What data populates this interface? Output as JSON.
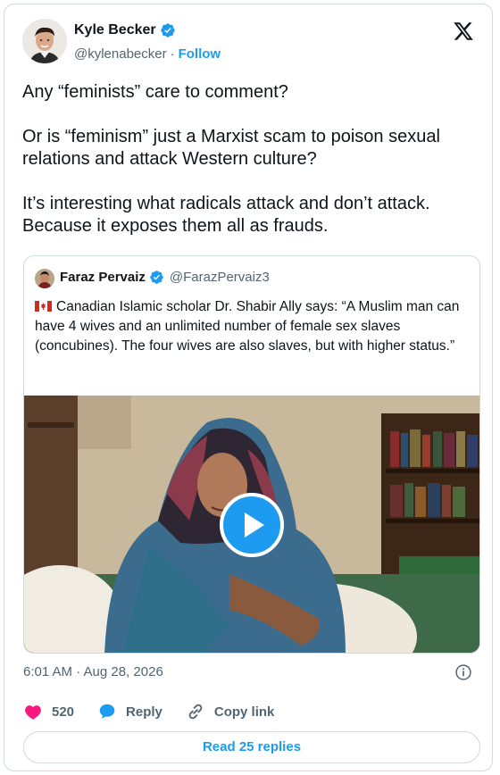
{
  "author": {
    "display_name": "Kyle Becker",
    "handle": "@kylenabecker",
    "separator": "·",
    "follow_label": "Follow"
  },
  "tweet": {
    "paragraphs": [
      "Any “feminists” care to comment?",
      "Or is “feminism” just a Marxist scam to poison sexual relations and attack Western culture?",
      "It’s interesting what radicals attack and don’t attack. Because it exposes them all as frauds."
    ],
    "timestamp": "6:01 AM · Aug 28, 2026"
  },
  "quote": {
    "display_name": "Faraz Pervaiz",
    "handle": "@FarazPervaiz3",
    "text": "Canadian Islamic scholar Dr. Shabir Ally says: “A Muslim man can have 4 wives and an unlimited number of female sex slaves (concubines). The four wives are also slaves, but with higher status.”",
    "flag_icon": "canada-flag-icon",
    "media_icon": "play-icon"
  },
  "actions": {
    "like_count": "520",
    "reply_label": "Reply",
    "copy_label": "Copy link"
  },
  "read_replies_label": "Read 25 replies",
  "colors": {
    "accent": "#1d9bf0",
    "like": "#f91880",
    "muted": "#536471",
    "border": "#cfd9de"
  }
}
